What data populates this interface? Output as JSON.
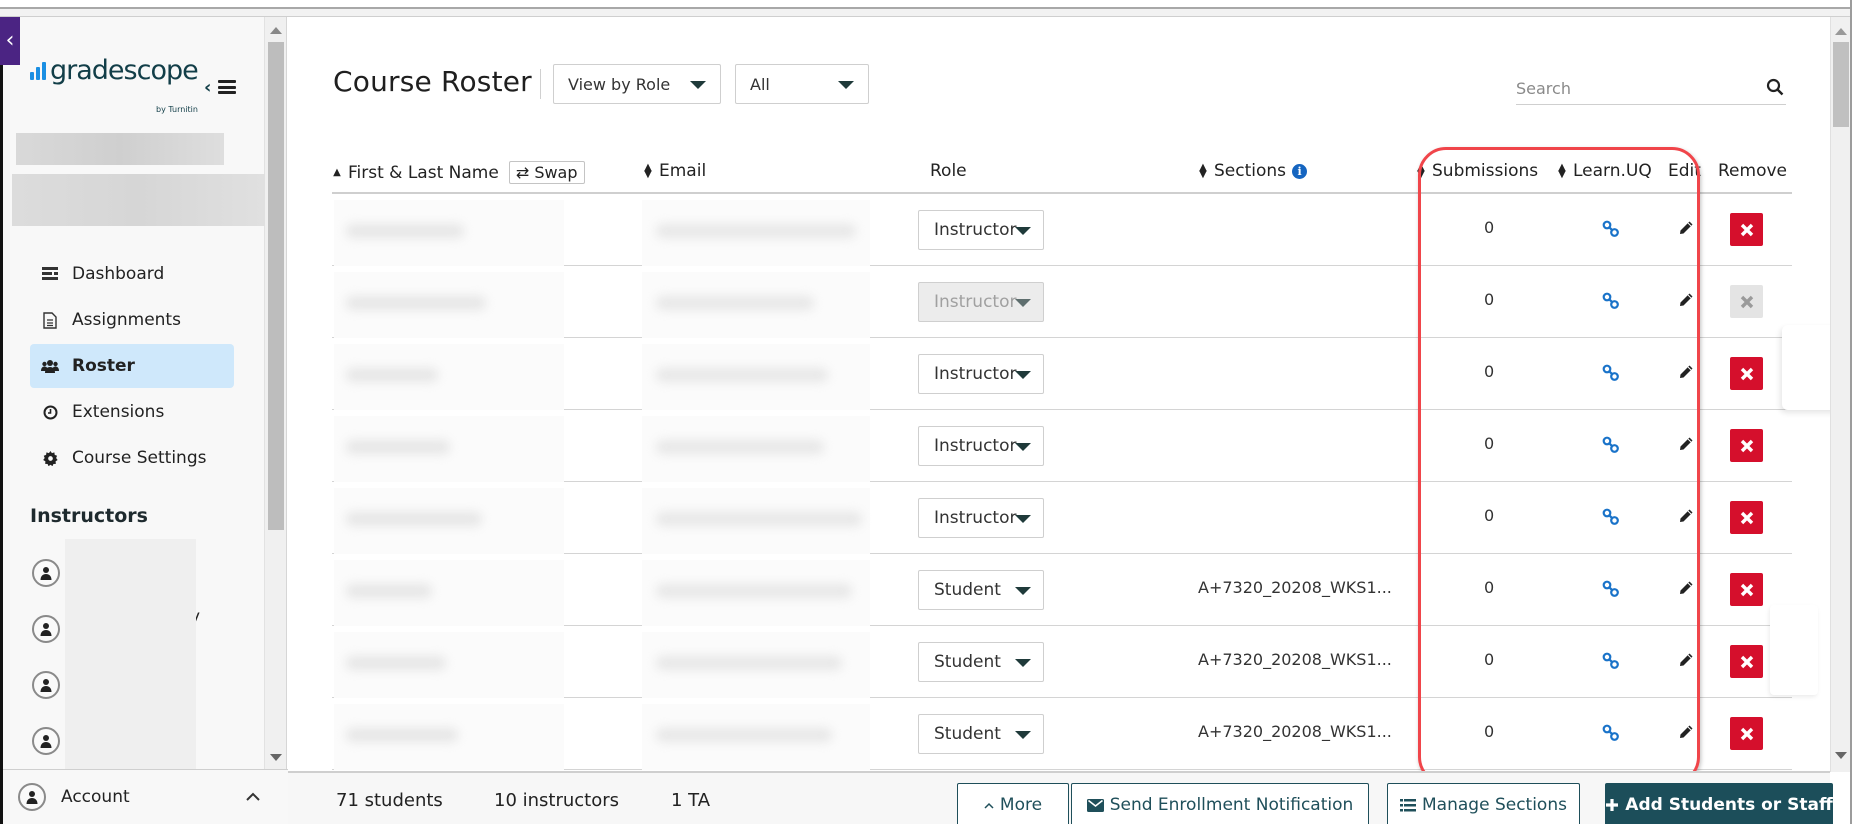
{
  "sidebar": {
    "logo_text": "gradescope",
    "logo_sub": "by Turnitin",
    "close_glyph": "×",
    "nav": [
      {
        "label": "Dashboard",
        "icon": "dashboard-icon",
        "active": false
      },
      {
        "label": "Assignments",
        "icon": "document-icon",
        "active": false
      },
      {
        "label": "Roster",
        "icon": "users-icon",
        "active": true
      },
      {
        "label": "Extensions",
        "icon": "clock-icon",
        "active": false
      },
      {
        "label": "Course Settings",
        "icon": "gear-icon",
        "active": false
      }
    ],
    "instructors_title": "Instructors",
    "instructor_fragment": "y",
    "account_label": "Account"
  },
  "header": {
    "title": "Course Roster",
    "view_select": "View by Role",
    "filter_select": "All",
    "search_placeholder": "Search"
  },
  "table": {
    "columns": {
      "name": "First & Last Name",
      "swap": "Swap",
      "email": "Email",
      "role": "Role",
      "sections": "Sections",
      "submissions": "Submissions",
      "lms": "Learn.UQ",
      "edit": "Edit",
      "remove": "Remove"
    },
    "rows": [
      {
        "role": "Instructor",
        "role_disabled": false,
        "section": "",
        "submissions": "0",
        "remove_disabled": false
      },
      {
        "role": "Instructor",
        "role_disabled": true,
        "section": "",
        "submissions": "0",
        "remove_disabled": true
      },
      {
        "role": "Instructor",
        "role_disabled": false,
        "section": "",
        "submissions": "0",
        "remove_disabled": false
      },
      {
        "role": "Instructor",
        "role_disabled": false,
        "section": "",
        "submissions": "0",
        "remove_disabled": false
      },
      {
        "role": "Instructor",
        "role_disabled": false,
        "section": "",
        "submissions": "0",
        "remove_disabled": false
      },
      {
        "role": "Student",
        "role_disabled": false,
        "section": "A+7320_20208_WKS1...",
        "submissions": "0",
        "remove_disabled": false
      },
      {
        "role": "Student",
        "role_disabled": false,
        "section": "A+7320_20208_WKS1...",
        "submissions": "0",
        "remove_disabled": false
      },
      {
        "role": "Student",
        "role_disabled": false,
        "section": "A+7320_20208_WKS1...",
        "submissions": "0",
        "remove_disabled": false
      }
    ]
  },
  "footer": {
    "students": "71 students",
    "instructors": "10 instructors",
    "tas": "1 TA",
    "more": "More",
    "send_notification": "Send Enrollment Notification",
    "manage_sections": "Manage Sections",
    "add_people": "Add Students or Staff"
  },
  "colors": {
    "accent_dark": "#1c4e5a",
    "remove_red": "#d50f2c",
    "link_blue": "#1a73c9",
    "active_nav": "#cfe8fb",
    "highlight": "#f0454a",
    "brand_purple": "#4b2483"
  }
}
